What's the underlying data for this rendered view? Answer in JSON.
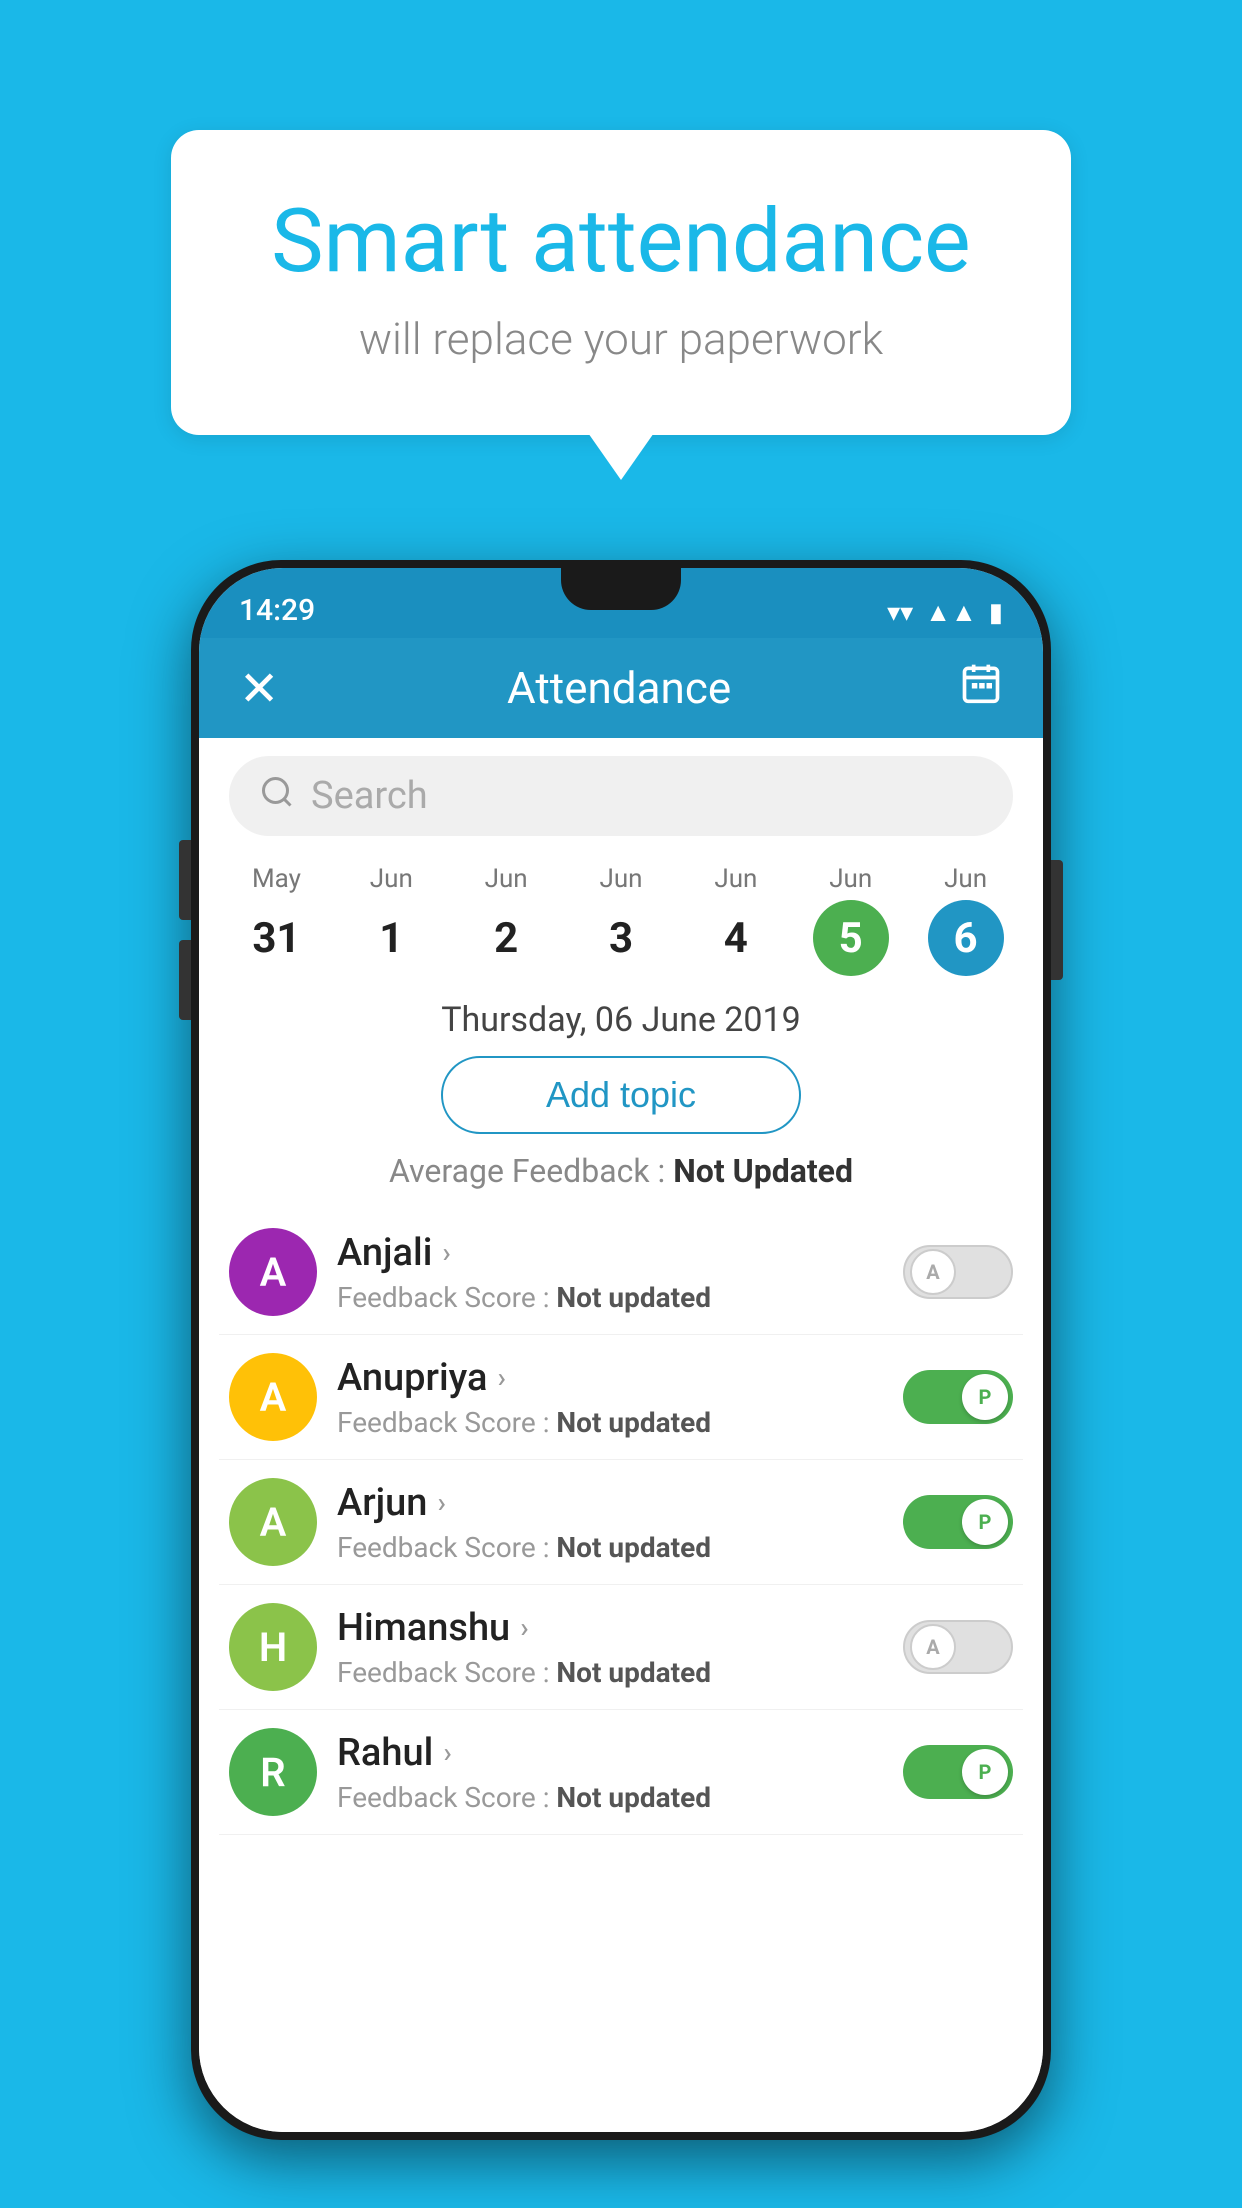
{
  "background_color": "#1ab8e8",
  "hero": {
    "title": "Smart attendance",
    "subtitle": "will replace your paperwork"
  },
  "status_bar": {
    "time": "14:29",
    "icons": [
      "wifi",
      "signal",
      "battery"
    ]
  },
  "toolbar": {
    "title": "Attendance",
    "close_icon": "✕",
    "calendar_icon": "📅"
  },
  "search": {
    "placeholder": "Search"
  },
  "calendar": {
    "days": [
      {
        "month": "May",
        "date": "31",
        "state": "normal"
      },
      {
        "month": "Jun",
        "date": "1",
        "state": "normal"
      },
      {
        "month": "Jun",
        "date": "2",
        "state": "normal"
      },
      {
        "month": "Jun",
        "date": "3",
        "state": "normal"
      },
      {
        "month": "Jun",
        "date": "4",
        "state": "normal"
      },
      {
        "month": "Jun",
        "date": "5",
        "state": "today"
      },
      {
        "month": "Jun",
        "date": "6",
        "state": "selected"
      }
    ]
  },
  "selected_date": "Thursday, 06 June 2019",
  "add_topic_label": "Add topic",
  "average_feedback_label": "Average Feedback :",
  "average_feedback_value": "Not Updated",
  "students": [
    {
      "name": "Anjali",
      "initial": "A",
      "avatar_color": "#9c27b0",
      "feedback_label": "Feedback Score :",
      "feedback_value": "Not updated",
      "attendance": "absent",
      "toggle_letter": "A"
    },
    {
      "name": "Anupriya",
      "initial": "A",
      "avatar_color": "#ffc107",
      "feedback_label": "Feedback Score :",
      "feedback_value": "Not updated",
      "attendance": "present",
      "toggle_letter": "P"
    },
    {
      "name": "Arjun",
      "initial": "A",
      "avatar_color": "#8bc34a",
      "feedback_label": "Feedback Score :",
      "feedback_value": "Not updated",
      "attendance": "present",
      "toggle_letter": "P"
    },
    {
      "name": "Himanshu",
      "initial": "H",
      "avatar_color": "#8bc34a",
      "feedback_label": "Feedback Score :",
      "feedback_value": "Not updated",
      "attendance": "absent",
      "toggle_letter": "A"
    },
    {
      "name": "Rahul",
      "initial": "R",
      "avatar_color": "#4caf50",
      "feedback_label": "Feedback Score :",
      "feedback_value": "Not updated",
      "attendance": "present",
      "toggle_letter": "P"
    }
  ]
}
